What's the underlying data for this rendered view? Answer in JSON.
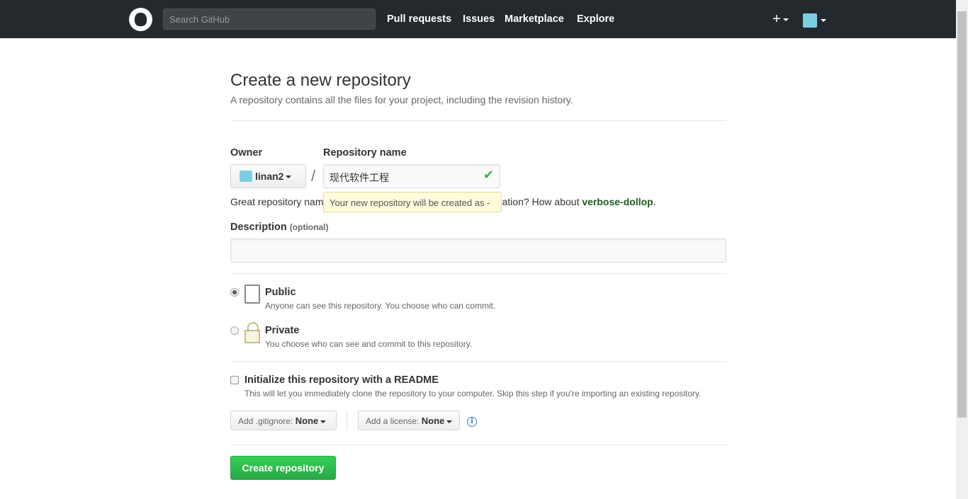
{
  "header": {
    "search_placeholder": "Search GitHub",
    "nav": [
      "Pull requests",
      "Issues",
      "Marketplace",
      "Explore"
    ],
    "new_icon": "+"
  },
  "page": {
    "title": "Create a new repository",
    "subtitle": "A repository contains all the files for your project, including the revision history."
  },
  "form": {
    "owner_label": "Owner",
    "owner_value": "linan2",
    "slash": "/",
    "repo_label": "Repository name",
    "repo_value": "现代软件工程",
    "check": "✔",
    "hint_prefix": "Great repository nam",
    "hint_suffix": "ation? How about ",
    "hint_suggestion": "verbose-dollop",
    "tooltip": "Your new repository will be created as -",
    "description_label": "Description",
    "description_optional": "(optional)",
    "description_value": "",
    "visibility": [
      {
        "title": "Public",
        "desc": "Anyone can see this repository. You choose who can commit.",
        "selected": true
      },
      {
        "title": "Private",
        "desc": "You choose who can see and commit to this repository.",
        "selected": false
      }
    ],
    "readme_label": "Initialize this repository with a README",
    "readme_desc": "This will let you immediately clone the repository to your computer. Skip this step if you're importing an existing repository.",
    "readme_checked": false,
    "gitignore_label": "Add .gitignore:",
    "gitignore_value": "None",
    "license_label": "Add a license:",
    "license_value": "None",
    "info_icon": "i",
    "submit": "Create repository"
  },
  "colors": {
    "header_bg": "#24292e",
    "primary": "#28a745",
    "tooltip_bg": "#fffbdd"
  }
}
